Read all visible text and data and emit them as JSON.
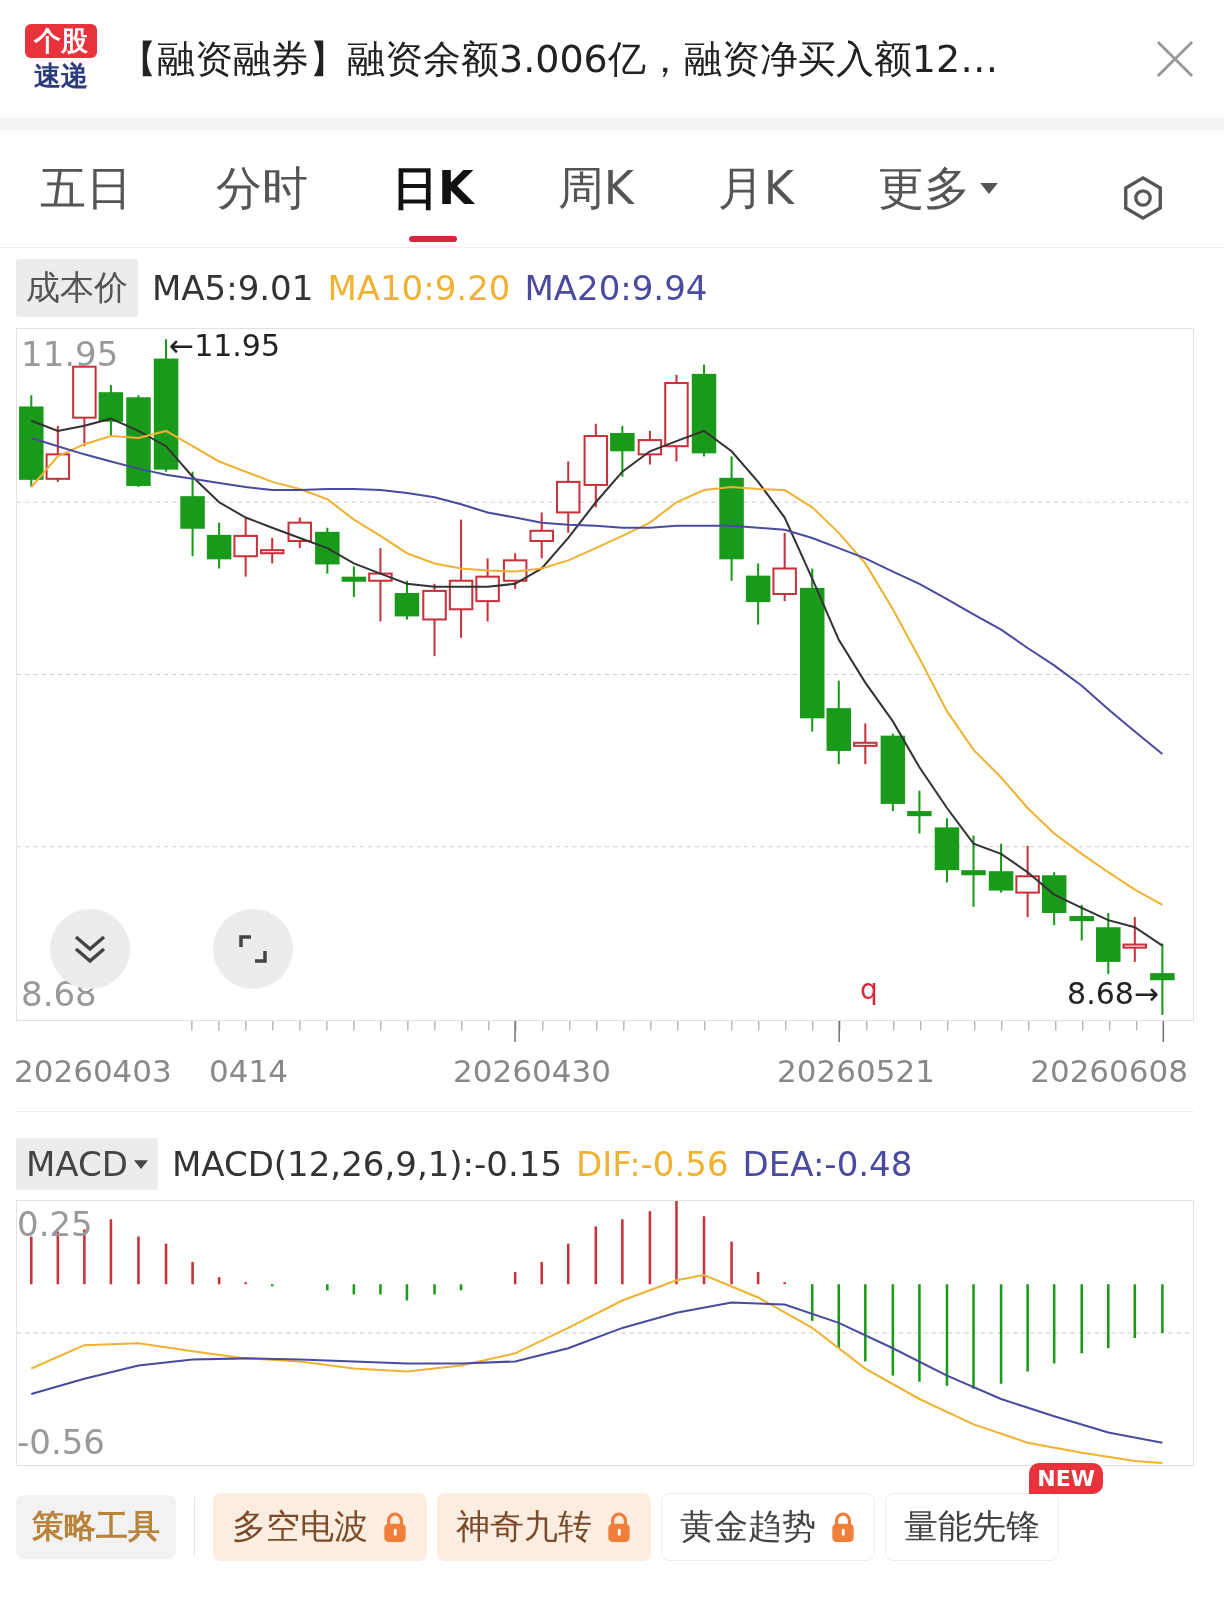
{
  "header": {
    "badge_top": "个股",
    "badge_bottom": "速递",
    "headline": "【融资融券】融资余额3.006亿，融资净买入额12…"
  },
  "tabs": [
    {
      "label": "五日",
      "selected": false,
      "kind": "plain"
    },
    {
      "label": "分时",
      "selected": false,
      "kind": "plain"
    },
    {
      "label": "日K",
      "selected": true,
      "kind": "plain"
    },
    {
      "label": "周K",
      "selected": false,
      "kind": "plain"
    },
    {
      "label": "月K",
      "selected": false,
      "kind": "plain"
    },
    {
      "label": "更多",
      "selected": false,
      "kind": "dropdown"
    }
  ],
  "indicator": {
    "cost_button": "成本价",
    "ma": [
      {
        "label": "MA5:9.01",
        "color": "#333333"
      },
      {
        "label": "MA10:9.20",
        "color": "#f0b232"
      },
      {
        "label": "MA20:9.94",
        "color": "#4a4a9e"
      }
    ]
  },
  "price_chart": {
    "top_label": "11.95",
    "high_marker": "←11.95",
    "bottom_label": "8.68",
    "low_marker": "8.68→",
    "event_marker": "q",
    "dates": [
      "20260403",
      "0414",
      "20260430",
      "20260521",
      "20260608"
    ]
  },
  "macd": {
    "selector": "MACD",
    "readings": [
      {
        "label": "MACD(12,26,9,1):-0.15",
        "color": "#333333"
      },
      {
        "label": "DIF:-0.56",
        "color": "#f0b232"
      },
      {
        "label": "DEA:-0.48",
        "color": "#4a4a9e"
      }
    ],
    "top_label": "0.25",
    "bottom_label": "-0.56"
  },
  "tools": {
    "title": "策略工具",
    "items": [
      {
        "label": "多空电波",
        "locked": true,
        "highlighted": true
      },
      {
        "label": "神奇九转",
        "locked": true,
        "highlighted": true
      },
      {
        "label": "黄金趋势",
        "locked": true,
        "highlighted": false
      },
      {
        "label": "量能先锋",
        "locked": false,
        "highlighted": false,
        "badge": "NEW"
      }
    ]
  }
}
